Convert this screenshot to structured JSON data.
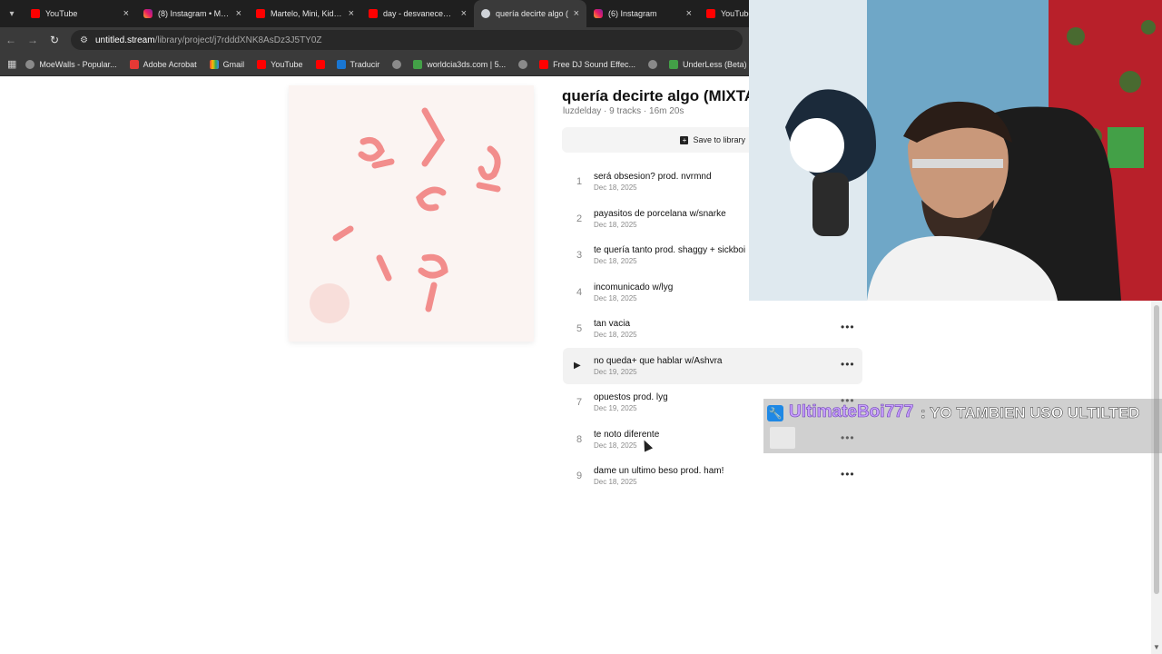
{
  "browser": {
    "tabs": [
      {
        "title": "YouTube",
        "icon": "youtube-icon",
        "active": false
      },
      {
        "title": "(8) Instagram • Mens",
        "icon": "instagram-icon",
        "active": false
      },
      {
        "title": "Martelo, Mini, Kidd A",
        "icon": "youtube-icon",
        "active": false
      },
      {
        "title": "day - desvanecemos",
        "icon": "youtube-icon",
        "active": false
      },
      {
        "title": "quería decirte algo (",
        "icon": "untitled-icon",
        "active": true
      },
      {
        "title": "(6) Instagram",
        "icon": "instagram-icon",
        "active": false
      },
      {
        "title": "YouTube",
        "icon": "youtube-icon",
        "active": false
      }
    ],
    "url_host": "untitled.stream",
    "url_path": "/library/project/j7rdddXNK8AsDz3J5TY0Z",
    "bookmarks": [
      {
        "label": "MoeWalls - Popular...",
        "icon": "globe-icon"
      },
      {
        "label": "Adobe Acrobat",
        "icon": "acrobat-icon"
      },
      {
        "label": "Gmail",
        "icon": "gmail-icon"
      },
      {
        "label": "YouTube",
        "icon": "youtube-icon"
      },
      {
        "label": "",
        "icon": "youtube-icon"
      },
      {
        "label": "Traducir",
        "icon": "translate-icon"
      },
      {
        "label": "",
        "icon": "globe-icon"
      },
      {
        "label": "worldcia3ds.com | 5...",
        "icon": "site-icon"
      },
      {
        "label": "",
        "icon": "globe-icon"
      },
      {
        "label": "Free DJ Sound Effec...",
        "icon": "youtube-icon"
      },
      {
        "label": "",
        "icon": "globe-icon"
      },
      {
        "label": "UnderLess (Beta)",
        "icon": "underless-icon"
      }
    ]
  },
  "album": {
    "title": "quería decirte algo (MIXTAPE)",
    "meta": "luzdelday · 9 tracks · 16m 20s",
    "save_label": "Save to library"
  },
  "tracks": [
    {
      "num": "1",
      "title": "será obsesion? prod. nvrmnd",
      "date": "Dec 18, 2025",
      "more": false
    },
    {
      "num": "2",
      "title": "payasitos de porcelana w/snarke",
      "date": "Dec 18, 2025",
      "more": false
    },
    {
      "num": "3",
      "title": "te quería tanto prod. shaggy + sickboi",
      "date": "Dec 18, 2025",
      "more": true
    },
    {
      "num": "4",
      "title": "incomunicado w/lyg",
      "date": "Dec 18, 2025",
      "more": true
    },
    {
      "num": "5",
      "title": "tan vacia",
      "date": "Dec 18, 2025",
      "more": true
    },
    {
      "num": "6",
      "title": "no queda+ que hablar w/Ashvra",
      "date": "Dec 19, 2025",
      "more": true,
      "hover": true
    },
    {
      "num": "7",
      "title": "opuestos prod. lyg",
      "date": "Dec 19, 2025",
      "more": true
    },
    {
      "num": "8",
      "title": "te noto diferente",
      "date": "Dec 18, 2025",
      "more": true
    },
    {
      "num": "9",
      "title": "dame un ultimo beso prod. ham!",
      "date": "Dec 18, 2025",
      "more": true
    }
  ],
  "chat": {
    "user": "UltimateBoi777",
    "message": ": YO TAMBIEN USO ULTILTED",
    "user_color": "#c9a0ff"
  },
  "colors": {
    "chrome_dark": "#1f1f1f",
    "chrome_mid": "#3a3a3a",
    "youtube_red": "#ff0000"
  }
}
